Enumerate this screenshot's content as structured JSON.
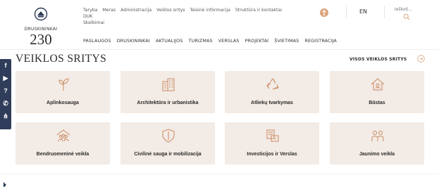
{
  "logo": {
    "name": "DRUSKININKAI",
    "number": "230"
  },
  "top_links": [
    "Taryba",
    "Meras",
    "Administracija",
    "Veiklos sritys",
    "Teisinė informacija",
    "Struktūra ir kontaktai",
    "DUK",
    "Skelbimai"
  ],
  "language": "EN",
  "search": {
    "placeholder": "Ieškoti..."
  },
  "main_nav": [
    "PASLAUGOS",
    "DRUSKININKAI",
    "AKTUALIJOS",
    "TURIZMAS",
    "VERSLAS",
    "PROJEKTAI",
    "ŠVIETIMAS",
    "REGISTRACIJA"
  ],
  "section": {
    "title": "VEIKLOS SRITYS",
    "all_link": "VISOS VEIKLOS SRITYS"
  },
  "cards": [
    {
      "label": "Aplinkosauga",
      "icon": "sprout-icon"
    },
    {
      "label": "Architektūra ir urbanistika",
      "icon": "buildings-icon"
    },
    {
      "label": "Atliekų tvarkymas",
      "icon": "recycle-icon"
    },
    {
      "label": "Būstas",
      "icon": "house-icon"
    },
    {
      "label": "Bendruomeninė veikla",
      "icon": "community-icon"
    },
    {
      "label": "Civilinė sauga ir mobilizacija",
      "icon": "shield-icon"
    },
    {
      "label": "Investicijos ir Verslas",
      "icon": "investment-icon"
    },
    {
      "label": "Jaunimo veikla",
      "icon": "youth-icon"
    }
  ],
  "social": [
    "facebook-icon",
    "youtube-icon",
    "help-icon",
    "phone-icon",
    "sitemap-icon"
  ],
  "colors": {
    "card_bg": "#f3ebe5",
    "icon_stroke": "#c98a62",
    "social_bg": "#2f3d5a",
    "accent": "#d9a27a"
  }
}
